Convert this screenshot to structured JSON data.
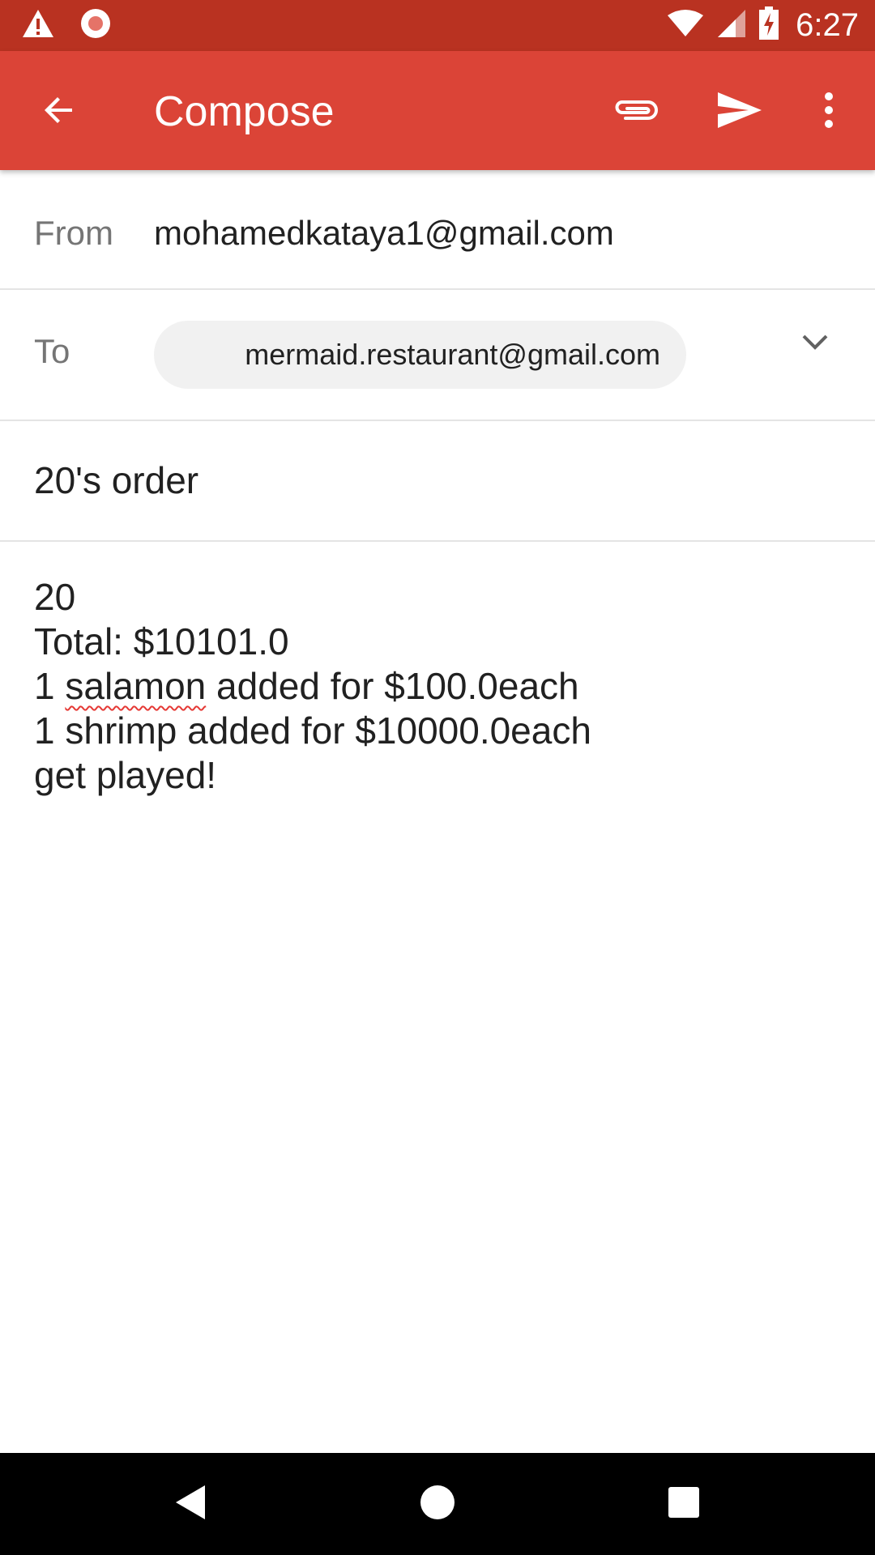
{
  "status_bar": {
    "time": "6:27",
    "icons": [
      "alert-icon",
      "record-icon",
      "wifi-icon",
      "signal-icon",
      "battery-charging-icon"
    ]
  },
  "app_bar": {
    "title": "Compose",
    "icons": [
      "back-arrow-icon",
      "paperclip-icon",
      "send-icon",
      "more-vert-icon"
    ]
  },
  "from": {
    "label": "From",
    "value": "mohamedkataya1@gmail.com"
  },
  "to": {
    "label": "To",
    "recipient": "mermaid.restaurant@gmail.com"
  },
  "subject": "20's order",
  "body": {
    "line1": "20",
    "line2": "Total: $10101.0",
    "line3_prefix": "1 ",
    "line3_misspelled": "salamon",
    "line3_suffix": " added for $100.0each",
    "line4": "1 shrimp added for $10000.0each",
    "line5": "get played!"
  },
  "nav_bar": {
    "icons": [
      "nav-back-icon",
      "nav-home-icon",
      "nav-recents-icon"
    ]
  },
  "colors": {
    "status_bar": "#b93221",
    "app_bar": "#db4437",
    "chip_bg": "#f1f1f1",
    "divider": "#e4e4e4"
  }
}
